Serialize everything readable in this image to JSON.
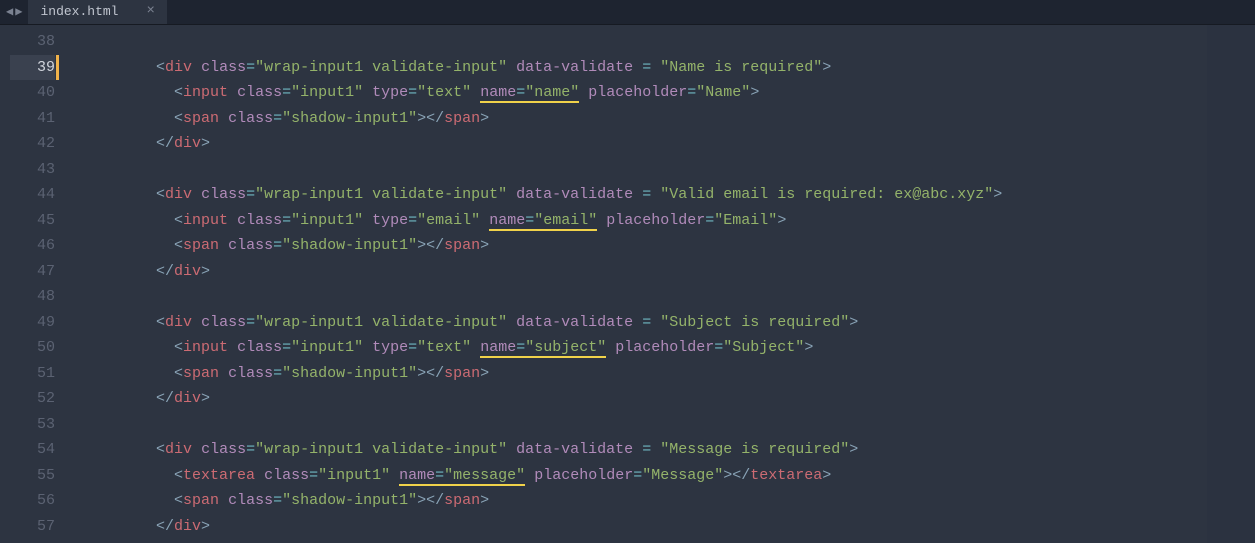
{
  "tab": {
    "title": "index.html"
  },
  "line_numbers": [
    "38",
    "39",
    "40",
    "41",
    "42",
    "43",
    "44",
    "45",
    "46",
    "47",
    "48",
    "49",
    "50",
    "51",
    "52",
    "53",
    "54",
    "55",
    "56",
    "57"
  ],
  "current_line_index": 1,
  "code": {
    "l39": {
      "tag_open": "div",
      "attr1": "class",
      "val1": "wrap-input1 validate-input",
      "attr2": "data-validate",
      "val2": "Name is required"
    },
    "l40": {
      "tag_open": "input",
      "attr1": "class",
      "val1": "input1",
      "attr2": "type",
      "val2": "text",
      "attr3": "name",
      "val3": "name",
      "attr4": "placeholder",
      "val4": "Name"
    },
    "l41": {
      "tag_open": "span",
      "attr1": "class",
      "val1": "shadow-input1",
      "tag_close": "span"
    },
    "l42": {
      "tag_close": "div"
    },
    "l44": {
      "tag_open": "div",
      "attr1": "class",
      "val1": "wrap-input1 validate-input",
      "attr2": "data-validate",
      "val2": "Valid email is required: ex@abc.xyz"
    },
    "l45": {
      "tag_open": "input",
      "attr1": "class",
      "val1": "input1",
      "attr2": "type",
      "val2": "email",
      "attr3": "name",
      "val3": "email",
      "attr4": "placeholder",
      "val4": "Email"
    },
    "l46": {
      "tag_open": "span",
      "attr1": "class",
      "val1": "shadow-input1",
      "tag_close": "span"
    },
    "l47": {
      "tag_close": "div"
    },
    "l49": {
      "tag_open": "div",
      "attr1": "class",
      "val1": "wrap-input1 validate-input",
      "attr2": "data-validate",
      "val2": "Subject is required"
    },
    "l50": {
      "tag_open": "input",
      "attr1": "class",
      "val1": "input1",
      "attr2": "type",
      "val2": "text",
      "attr3": "name",
      "val3": "subject",
      "attr4": "placeholder",
      "val4": "Subject"
    },
    "l51": {
      "tag_open": "span",
      "attr1": "class",
      "val1": "shadow-input1",
      "tag_close": "span"
    },
    "l52": {
      "tag_close": "div"
    },
    "l54": {
      "tag_open": "div",
      "attr1": "class",
      "val1": "wrap-input1 validate-input",
      "attr2": "data-validate",
      "val2": "Message is required"
    },
    "l55": {
      "tag_open": "textarea",
      "attr1": "class",
      "val1": "input1",
      "attr2": "name",
      "val2": "message",
      "attr3": "placeholder",
      "val3": "Message",
      "tag_close": "textarea"
    },
    "l56": {
      "tag_open": "span",
      "attr1": "class",
      "val1": "shadow-input1",
      "tag_close": "span"
    },
    "l57": {
      "tag_close": "div"
    }
  }
}
